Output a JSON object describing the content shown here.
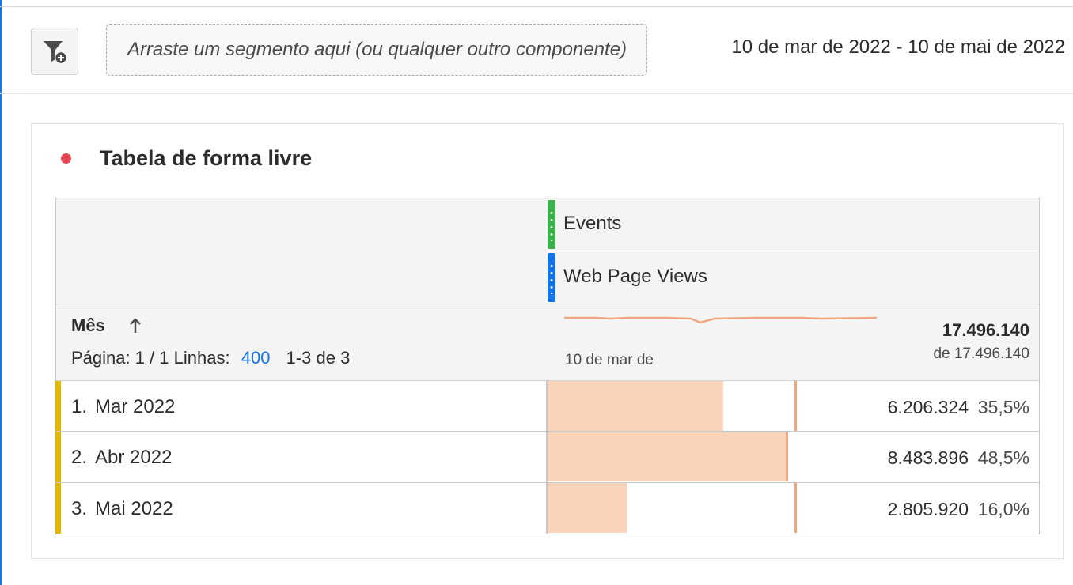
{
  "toolbar": {
    "segment_placeholder": "Arraste um segmento aqui (ou qualquer outro componente)",
    "date_range": "10 de mar de 2022 - 10 de mai de 2022",
    "filter_icon": "filter-add-icon"
  },
  "panel": {
    "title": "Tabela de forma livre",
    "status_color": "#e34850"
  },
  "table": {
    "metrics": [
      {
        "label": "Events",
        "color": "#3bb34a"
      },
      {
        "label": "Web Page Views",
        "color": "#1473e6"
      }
    ],
    "dimension": {
      "name": "Mês",
      "sort_icon": "arrow-up-icon",
      "page_label": "Página: 1 / 1",
      "rows_label": "Linhas:",
      "rows_value": "400",
      "range_label": "1-3 de 3"
    },
    "sparkline_date": "10 de mar de",
    "total": {
      "value": "17.496.140",
      "of": "de 17.496.140"
    },
    "rows": [
      {
        "index": "1.",
        "label": "Mar 2022",
        "value": "6.206.324",
        "percent": "35,5%",
        "share": 0.355
      },
      {
        "index": "2.",
        "label": "Abr 2022",
        "value": "8.483.896",
        "percent": "48,5%",
        "share": 0.485
      },
      {
        "index": "3.",
        "label": "Mai 2022",
        "value": "2.805.920",
        "percent": "16,0%",
        "share": 0.16
      }
    ],
    "bar_color": "#f9d4ba",
    "row_accent_color": "#e1b800"
  }
}
